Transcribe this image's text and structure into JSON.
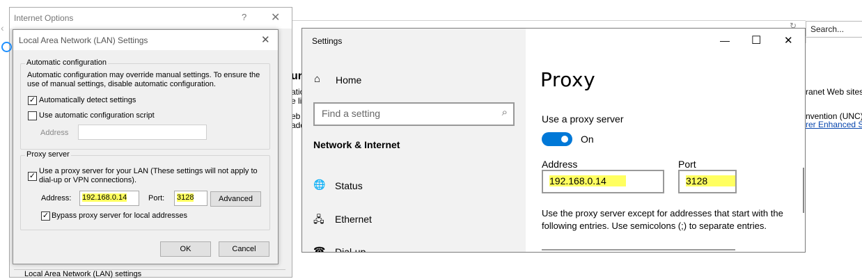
{
  "background_page": {
    "search_placeholder": "Search...",
    "fragments": {
      "uri": "uri",
      "atio": "atio",
      "e_lis": "e lis",
      "eb": "eb",
      "add": "add",
      "ranet": "ranet Web sites",
      "nvention": "nvention (UNC)",
      "rer": "rer Enhanced S"
    }
  },
  "internet_options": {
    "title": "Internet Options",
    "help_glyph": "?",
    "close_glyph": "✕",
    "bottom_fragment": "Local Area Network (LAN) settings"
  },
  "lan_dialog": {
    "title": "Local Area Network (LAN) Settings",
    "close_glyph": "✕",
    "auto_config": {
      "group_label": "Automatic configuration",
      "description": "Automatic configuration may override manual settings.  To ensure the use of manual settings, disable automatic configuration.",
      "auto_detect_label": "Automatically detect settings",
      "auto_detect_checked": true,
      "script_label": "Use automatic configuration script",
      "script_checked": false,
      "address_label": "Address",
      "address_value": ""
    },
    "proxy": {
      "group_label": "Proxy server",
      "use_proxy_label": "Use a proxy server for your LAN (These settings will not apply to dial-up or VPN connections).",
      "use_proxy_checked": true,
      "address_label": "Address:",
      "address_value": "192.168.0.14",
      "port_label": "Port:",
      "port_value": "3128",
      "advanced_label": "Advanced",
      "bypass_label": "Bypass proxy server for local addresses",
      "bypass_checked": true
    },
    "ok_label": "OK",
    "cancel_label": "Cancel",
    "check_glyph": "✓"
  },
  "settings_window": {
    "title": "Settings",
    "controls": {
      "minimize": "—",
      "maximize": "☐",
      "close": "✕"
    },
    "nav": {
      "home_label": "Home",
      "search_placeholder": "Find a setting",
      "section_heading": "Network & Internet",
      "items": [
        {
          "label": "Status",
          "icon": "globe-icon",
          "glyph": "🌐"
        },
        {
          "label": "Ethernet",
          "icon": "ethernet-icon",
          "glyph": "🖧"
        },
        {
          "label": "Dial-up",
          "icon": "dialup-icon",
          "glyph": "☎"
        }
      ]
    },
    "main": {
      "heading": "Proxy",
      "use_proxy_label": "Use a proxy server",
      "toggle_state": "On",
      "toggle_on": true,
      "address_label": "Address",
      "address_value": "192.168.0.14",
      "port_label": "Port",
      "port_value": "3128",
      "exceptions_description": "Use the proxy server except for addresses that start with the following entries. Use semicolons (;) to separate entries."
    }
  },
  "colors": {
    "accent": "#0078d7",
    "highlight": "#ffff60",
    "dialog_bg": "#f0f0f0",
    "settings_nav_bg": "#f2f2f2"
  }
}
